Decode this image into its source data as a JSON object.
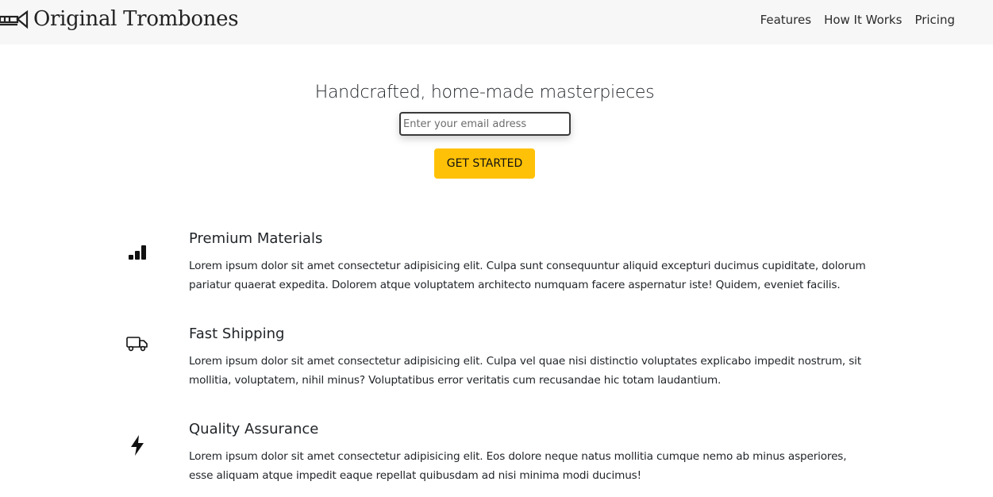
{
  "header": {
    "brand": "Original Trombones",
    "nav": [
      "Features",
      "How It Works",
      "Pricing"
    ]
  },
  "hero": {
    "title": "Handcrafted, home-made masterpieces",
    "email_placeholder": "Enter your email adress",
    "cta_label": "GET STARTED"
  },
  "colors": {
    "accent": "#ffc107",
    "header_bg": "#f7f7f8",
    "text": "#212529"
  },
  "features": [
    {
      "icon": "bar-chart-icon",
      "title": "Premium Materials",
      "text": "Lorem ipsum dolor sit amet consectetur adipisicing elit. Culpa sunt consequuntur aliquid excepturi ducimus cupiditate, dolorum pariatur quaerat expedita. Dolorem atque voluptatem architecto numquam facere aspernatur iste! Quidem, eveniet facilis."
    },
    {
      "icon": "truck-icon",
      "title": "Fast Shipping",
      "text": "Lorem ipsum dolor sit amet consectetur adipisicing elit. Culpa vel quae nisi distinctio voluptates explicabo impedit nostrum, sit mollitia, voluptatem, nihil minus? Voluptatibus error veritatis cum recusandae hic totam laudantium."
    },
    {
      "icon": "bolt-icon",
      "title": "Quality Assurance",
      "text": "Lorem ipsum dolor sit amet consectetur adipisicing elit. Eos dolore neque natus mollitia cumque nemo ab minus asperiores, esse aliquam atque impedit eaque repellat quibusdam ad nisi minima modi ducimus!"
    }
  ]
}
